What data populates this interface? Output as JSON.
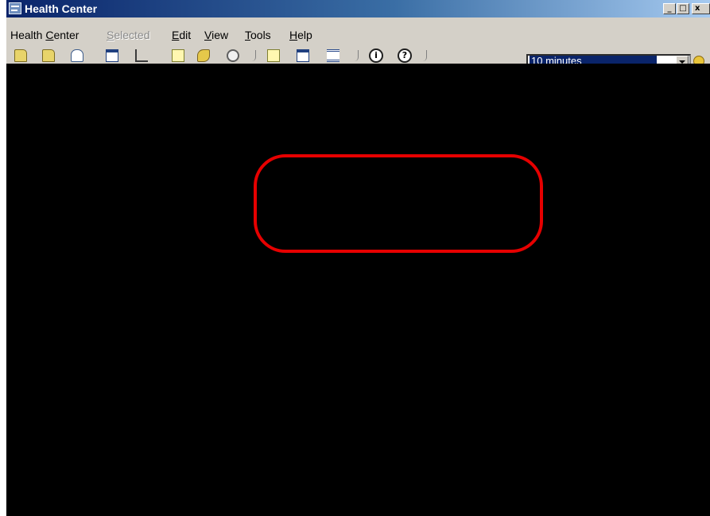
{
  "window": {
    "title": "Health Center",
    "icon": "health-center-icon",
    "controls": {
      "minimize": "_",
      "maximize": "□",
      "close": "x"
    }
  },
  "menu": [
    {
      "pre": "Health ",
      "mnemonic": "C",
      "post": "enter",
      "enabled": true
    },
    {
      "pre": "",
      "mnemonic": "S",
      "post": "elected",
      "enabled": false
    },
    {
      "pre": "",
      "mnemonic": "E",
      "post": "dit",
      "enabled": true
    },
    {
      "pre": "",
      "mnemonic": "V",
      "post": "iew",
      "enabled": true
    },
    {
      "pre": "",
      "mnemonic": "T",
      "post": "ools",
      "enabled": true
    },
    {
      "pre": "",
      "mnemonic": "H",
      "post": "elp",
      "enabled": true
    }
  ],
  "toolbar": {
    "icons": [
      "open-folder-icon",
      "refresh-folder-icon",
      "people-icon",
      "window-icon",
      "tree-icon",
      "note-icon",
      "key-icon",
      "tools-icon",
      "alerts-icon",
      "settings-icon",
      "list-icon",
      "info-icon",
      "help-icon"
    ],
    "info_glyph": "i",
    "help_glyph": "?",
    "refresh_interval": "10 minutes"
  },
  "overlay": {
    "highlight_color": "#e60000",
    "content_background": "#000000"
  }
}
